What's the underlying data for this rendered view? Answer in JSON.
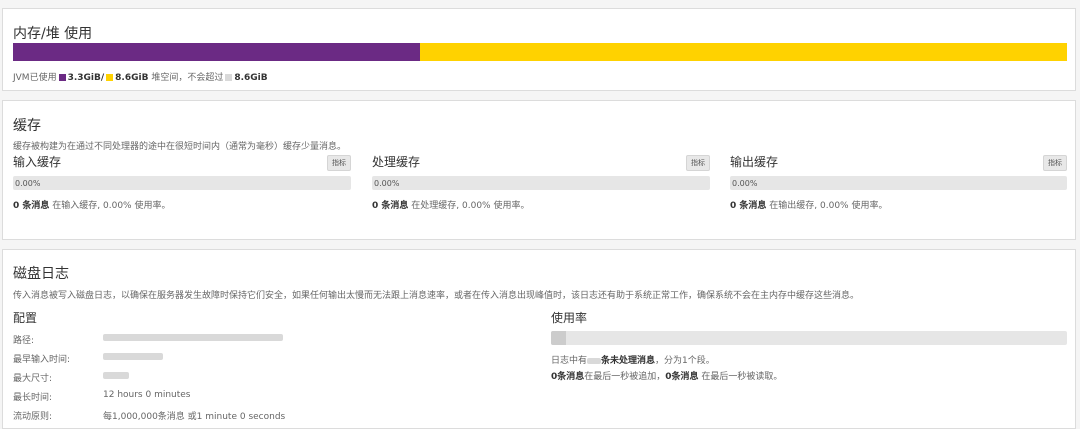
{
  "memory": {
    "title": "内存/堆 使用",
    "used_fraction": 0.386,
    "colors": {
      "used": "#6b2a84",
      "heap": "#ffd200",
      "limit": "#d9d9d9"
    },
    "legend": {
      "prefix": "JVM已使用",
      "used": "3.3GiB",
      "sep": "/",
      "heap": "8.6GiB",
      "heap_text": "堆空间，不会超过",
      "limit": "8.6GiB"
    }
  },
  "cache": {
    "title": "缓存",
    "description": "缓存被构建为在通过不同处理器的途中在很短时间内（通常为毫秒）缓存少量消息。",
    "metrics_label": "指标",
    "columns": [
      {
        "title": "输入缓存",
        "percent": "0.00%",
        "fill": 0,
        "count": "0 条消息",
        "desc": "在输入缓存, 0.00% 使用率。"
      },
      {
        "title": "处理缓存",
        "percent": "0.00%",
        "fill": 0,
        "count": "0 条消息",
        "desc": "在处理缓存, 0.00% 使用率。"
      },
      {
        "title": "输出缓存",
        "percent": "0.00%",
        "fill": 0,
        "count": "0 条消息",
        "desc": "在输出缓存, 0.00% 使用率。"
      }
    ]
  },
  "journal": {
    "title": "磁盘日志",
    "description": "传入消息被写入磁盘日志，以确保在服务器发生故障时保持它们安全，如果任何输出太慢而无法跟上消息速率，或者在传入消息出现峰值时，该日志还有助于系统正常工作，确保系统不会在主内存中缓存这些消息。",
    "config": {
      "title": "配置",
      "rows": [
        {
          "label": "路径:",
          "value": ""
        },
        {
          "label": "最早输入时间:",
          "value": ""
        },
        {
          "label": "最大尺寸:",
          "value": ""
        },
        {
          "label": "最长时间:",
          "value": "12 hours 0 minutes"
        },
        {
          "label": "流动原则:",
          "value": "每1,000,000条消息 或1 minute 0 seconds"
        }
      ]
    },
    "usage": {
      "title": "使用率",
      "fill": 0.03,
      "line1_a": "日志中有",
      "line1_b": "条未处理消息",
      "line1_c": "，分为1个段。",
      "line2_count1": "0条消息",
      "line2_text1": "在最后一秒被追加，",
      "line2_count2": "0条消息",
      "line2_text2": " 在最后一秒被读取。"
    }
  }
}
